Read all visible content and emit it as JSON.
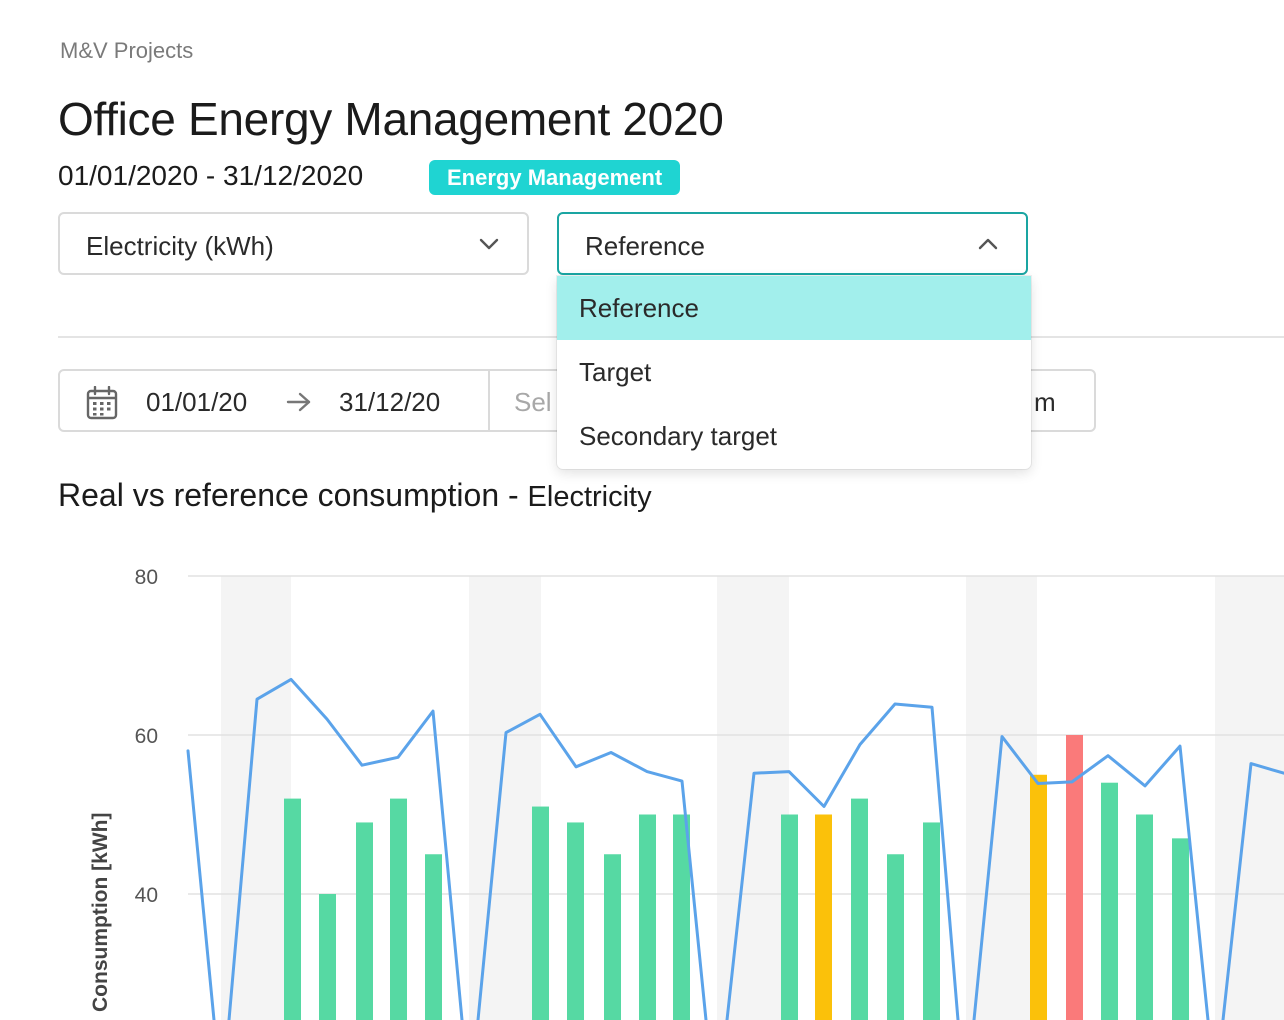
{
  "breadcrumb": "M&V Projects",
  "title": "Office Energy Management 2020",
  "date_range": "01/01/2020 - 31/12/2020",
  "tag": "Energy Management",
  "energy_select": {
    "value": "Electricity (kWh)",
    "icon": "chevron-down-icon"
  },
  "comparison_select": {
    "value": "Reference",
    "icon": "chevron-up-icon",
    "open": true,
    "options": [
      "Reference",
      "Target",
      "Secondary target"
    ],
    "selected_index": 0
  },
  "filters": {
    "from": "01/01/20",
    "to": "31/12/20",
    "select_placeholder_visible": "Sel",
    "period_fragment": "m"
  },
  "chart_header": {
    "title": "Real vs reference consumption",
    "separator": " - ",
    "subtitle": "Electricity"
  },
  "colors": {
    "accent": "#1fd4d2",
    "ok": "#56d9a3",
    "warning": "#fbc10a",
    "alert": "#fa7a7a",
    "reference_line": "#5ba3ea",
    "weekend_band": "#f4f4f4"
  },
  "chart_data": {
    "type": "bar",
    "ylabel": "Consumption [kWh]",
    "yticks": [
      40,
      60,
      80
    ],
    "grid": true,
    "visible_ylim": [
      25,
      80
    ],
    "series": [
      {
        "name": "",
        "kind": "bar",
        "values": [
          52,
          40,
          49,
          52,
          45,
          51,
          49,
          45,
          50,
          50,
          50,
          50,
          52,
          45,
          49,
          55,
          60,
          54,
          50,
          47
        ],
        "status": [
          "ok",
          "ok",
          "ok",
          "ok",
          "ok",
          "ok",
          "ok",
          "ok",
          "ok",
          "ok",
          "ok",
          "warning",
          "ok",
          "ok",
          "ok",
          "warning",
          "alert",
          "ok",
          "ok",
          "ok"
        ]
      },
      {
        "name": "",
        "kind": "line",
        "values": [
          58,
          64.5,
          67,
          62,
          56.2,
          57.2,
          63,
          60.3,
          62.6,
          56,
          57.8,
          55.4,
          54.2,
          55.2,
          55.4,
          51,
          58.8,
          63.9,
          63.5,
          59.8,
          53.9,
          54.1,
          57.4,
          53.6,
          58.6,
          56.4,
          55.2
        ]
      }
    ]
  }
}
